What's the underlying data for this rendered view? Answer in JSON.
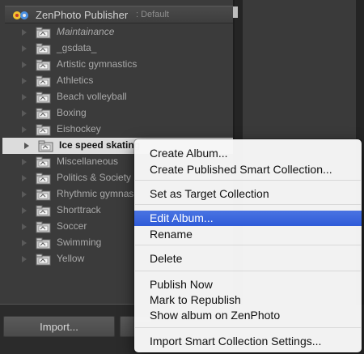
{
  "publisher": {
    "title": "ZenPhoto Publisher",
    "subtitle": ": Default"
  },
  "collections": [
    {
      "label": "Maintainance",
      "italic": true
    },
    {
      "label": "_gsdata_"
    },
    {
      "label": "Artistic gymnastics"
    },
    {
      "label": "Athletics"
    },
    {
      "label": "Beach volleyball"
    },
    {
      "label": "Boxing"
    },
    {
      "label": "Eishockey"
    },
    {
      "label": "Ice speed skating",
      "selected": true
    },
    {
      "label": "Miscellaneous"
    },
    {
      "label": "Politics & Society"
    },
    {
      "label": "Rhythmic gymnas"
    },
    {
      "label": "Shorttrack"
    },
    {
      "label": "Soccer"
    },
    {
      "label": "Swimming"
    },
    {
      "label": "Yellow"
    }
  ],
  "bottom": {
    "import_label": "Import..."
  },
  "context_menu": {
    "items": [
      {
        "label": "Create Album..."
      },
      {
        "label": "Create Published Smart Collection..."
      },
      {
        "label": "Set as Target Collection"
      },
      {
        "label": "Edit Album...",
        "highlighted": true
      },
      {
        "label": "Rename"
      },
      {
        "label": "Delete"
      },
      {
        "label": "Publish Now"
      },
      {
        "label": "Mark to Republish"
      },
      {
        "label": "Show album on ZenPhoto"
      },
      {
        "label": "Import Smart Collection Settings..."
      }
    ]
  },
  "colors": {
    "highlight": "#3a67dd",
    "panel": "#3b3b3b",
    "selected_row": "#dcdcdc"
  }
}
